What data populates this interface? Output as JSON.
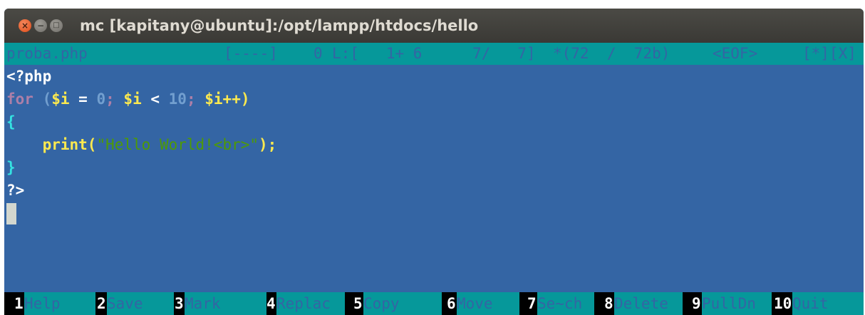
{
  "window": {
    "title": "mc [kapitany@ubuntu]:/opt/lampp/htdocs/hello",
    "close_glyph": "×",
    "min_glyph": "−",
    "max_glyph": "□"
  },
  "status": {
    "filename": "proba.php",
    "flags": "[----]",
    "col": "0",
    "lines": "L:[   1+ 6",
    "pos": "7/   7]",
    "size": "*(72  /  72b)",
    "eof": "<EOF>",
    "marks": "[*][X]"
  },
  "code": {
    "l1": "<?php",
    "for_kw": "for",
    "open_paren": " (",
    "var1": "$i",
    "eq": " = ",
    "zero": "0",
    "semi1": "; ",
    "var2": "$i",
    "lt": " < ",
    "ten": "10",
    "semi2": "; ",
    "var3": "$i",
    "incr": "++)",
    "brace_open": "{",
    "indent": "    ",
    "print_fn": "print",
    "print_open": "(",
    "string": "\"Hello World!<br>\"",
    "print_close": ");",
    "brace_close": "}",
    "l6": "?>"
  },
  "fkeys": [
    {
      "num": "1",
      "label": "Help"
    },
    {
      "num": "2",
      "label": "Save"
    },
    {
      "num": "3",
      "label": "Mark"
    },
    {
      "num": "4",
      "label": "Replac"
    },
    {
      "num": "5",
      "label": "Copy"
    },
    {
      "num": "6",
      "label": "Move"
    },
    {
      "num": "7",
      "label": "Se~ch"
    },
    {
      "num": "8",
      "label": "Delete"
    },
    {
      "num": "9",
      "label": "PullDn"
    },
    {
      "num": "10",
      "label": "Quit"
    }
  ],
  "colors": {
    "background": "#3465a4",
    "statusbar": "#06989a",
    "keyword": "#ad7fa8",
    "variable": "#fce94f",
    "string": "#4e9a06"
  }
}
